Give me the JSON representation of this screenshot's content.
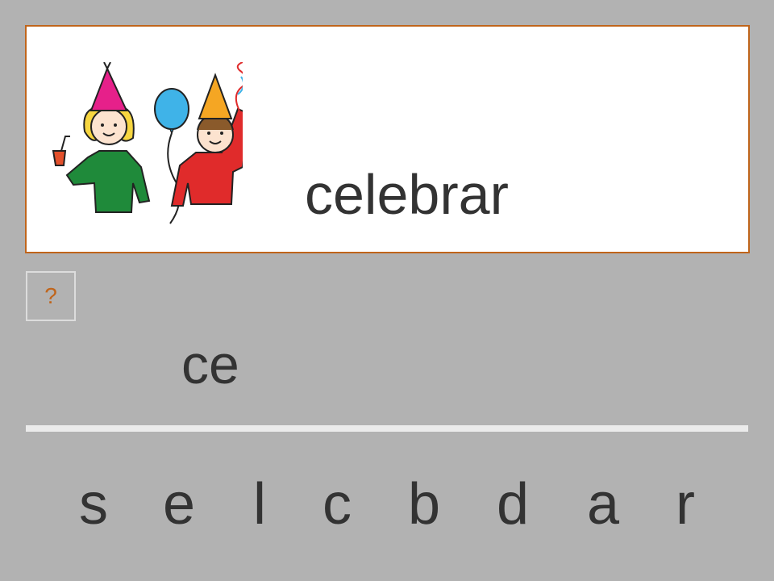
{
  "card": {
    "word": "celebrar",
    "image_icon": "children-celebrating-party-icon"
  },
  "hint": {
    "label": "?"
  },
  "answer": {
    "text": "ce"
  },
  "letters": [
    "s",
    "e",
    "l",
    "c",
    "b",
    "d",
    "a",
    "r"
  ],
  "colors": {
    "background": "#b2b2b2",
    "card_border": "#c0651b",
    "text": "#333333",
    "hint": "#c0651b",
    "divider": "#ebebeb"
  }
}
